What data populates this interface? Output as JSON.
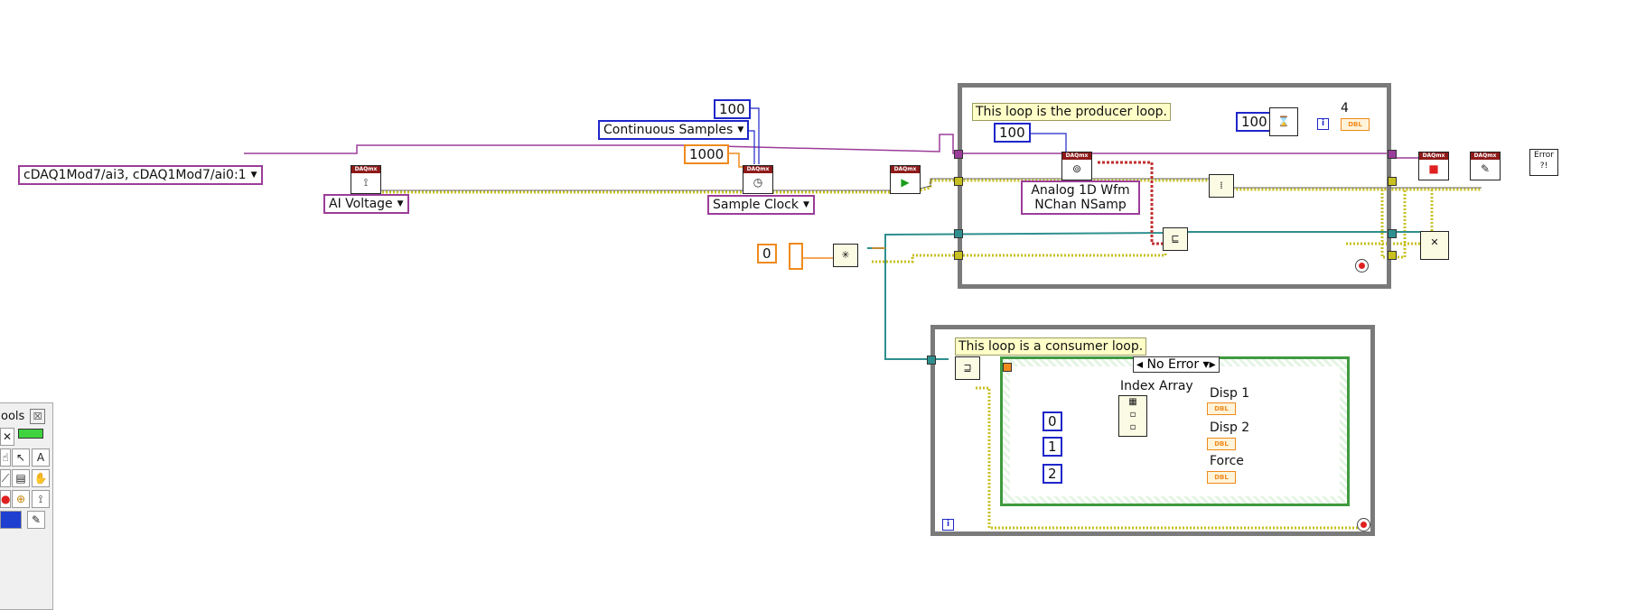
{
  "constants": {
    "channels": "cDAQ1Mod7/ai3, cDAQ1Mod7/ai0:1",
    "ai_voltage": "AI Voltage",
    "sample_mode": "Continuous Samples",
    "samples_per_channel": "100",
    "rate": "1000",
    "sample_clock": "Sample Clock",
    "read_samples": "100",
    "read_type_line1": "Analog 1D Wfm",
    "read_type_line2": "NChan NSamp",
    "wait_ms": "100",
    "iteration_count": "4",
    "queue_size": "0",
    "case_selector": "No Error",
    "index_0": "0",
    "index_1": "1",
    "index_2": "2"
  },
  "notes": {
    "producer": "This loop is the producer loop.",
    "consumer": "This loop is a consumer loop."
  },
  "labels": {
    "index_array": "Index Array",
    "disp1": "Disp 1",
    "disp2": "Disp 2",
    "force": "Force",
    "dbl": "DBL",
    "daqmx": "DAQmx",
    "error": "Error"
  },
  "palette": {
    "title": "ools",
    "close": "☒"
  },
  "colors": {
    "task_wire": "#9b3d9a",
    "error_wire": "#c8c020",
    "queue_wire": "#2f8f8f",
    "numeric_wire": "#f08a1d",
    "int_wire": "#1f26c9",
    "waveform_wire": "#c03030"
  }
}
